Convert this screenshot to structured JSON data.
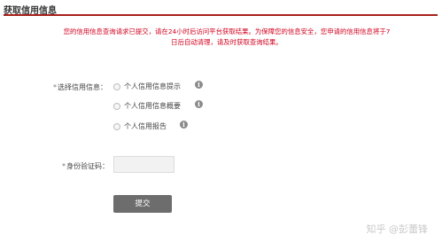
{
  "page": {
    "title": "获取信用信息",
    "notice_line1": "您的信用信息查询请求已提交，请在24小时后访问平台获取结果。为保障您的信息安全，您申请的信用信息将于7",
    "notice_line2": "日后自动清理，请及时获取查询结果。"
  },
  "colors": {
    "accent_rule": "#a8201a",
    "notice_text": "#d2001e",
    "submit_button": "#6d6d6d"
  },
  "form": {
    "select_info": {
      "required_mark": "*",
      "label": "选择信用信息：",
      "options": [
        {
          "label": "个人信用信息提示",
          "info_icon": "i"
        },
        {
          "label": "个人信用信息概要",
          "info_icon": "i"
        },
        {
          "label": "个人信用报告",
          "info_icon": "i"
        }
      ]
    },
    "verification_code": {
      "required_mark": "*",
      "label": "身份验证码：",
      "value": ""
    },
    "submit_label": "提交"
  },
  "watermark": "知乎 @彭蕾锋"
}
